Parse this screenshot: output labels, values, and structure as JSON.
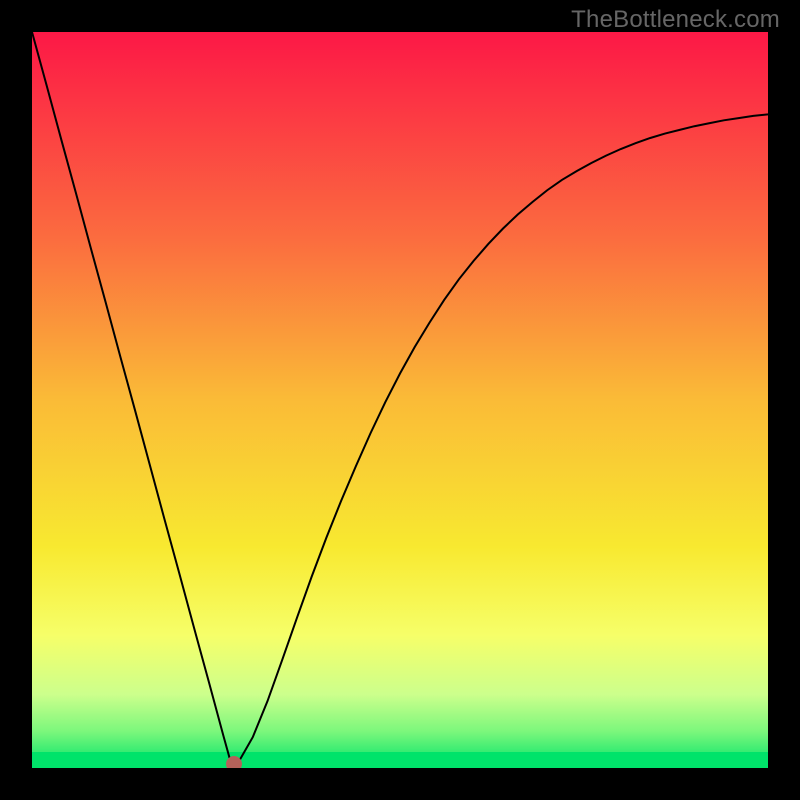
{
  "watermark": "TheBottleneck.com",
  "chart_data": {
    "type": "line",
    "title": "",
    "xlabel": "",
    "ylabel": "",
    "xlim": [
      0,
      100
    ],
    "ylim": [
      0,
      100
    ],
    "x": [
      0,
      2,
      4,
      6,
      8,
      10,
      12,
      14,
      16,
      18,
      20,
      22,
      24,
      26,
      27,
      28,
      30,
      32,
      34,
      36,
      38,
      40,
      42,
      44,
      46,
      48,
      50,
      52,
      54,
      56,
      58,
      60,
      62,
      64,
      66,
      68,
      70,
      72,
      74,
      76,
      78,
      80,
      82,
      84,
      86,
      88,
      90,
      92,
      94,
      96,
      98,
      100
    ],
    "y": [
      100,
      92.7,
      85.3,
      78.0,
      70.6,
      63.3,
      55.9,
      48.6,
      41.2,
      33.8,
      26.5,
      19.1,
      11.8,
      4.4,
      0.8,
      0.7,
      4.2,
      9.1,
      14.7,
      20.4,
      26.0,
      31.3,
      36.3,
      41.0,
      45.5,
      49.7,
      53.6,
      57.2,
      60.5,
      63.6,
      66.4,
      68.9,
      71.2,
      73.3,
      75.2,
      76.9,
      78.5,
      79.9,
      81.1,
      82.2,
      83.2,
      84.1,
      84.9,
      85.6,
      86.2,
      86.7,
      87.2,
      87.6,
      88.0,
      88.3,
      88.6,
      88.8
    ],
    "minimum_point": {
      "x": 27.5,
      "y": 0.5
    },
    "gradient_stops": [
      {
        "offset": 0,
        "color": "#fc1846"
      },
      {
        "offset": 28,
        "color": "#fb6c3f"
      },
      {
        "offset": 50,
        "color": "#fabb37"
      },
      {
        "offset": 70,
        "color": "#f8e930"
      },
      {
        "offset": 82,
        "color": "#f6ff69"
      },
      {
        "offset": 90,
        "color": "#ccff8c"
      },
      {
        "offset": 95,
        "color": "#7cf77c"
      },
      {
        "offset": 100,
        "color": "#00e36a"
      }
    ],
    "dot": {
      "color": "#b4625a",
      "radius_px": 8
    }
  }
}
